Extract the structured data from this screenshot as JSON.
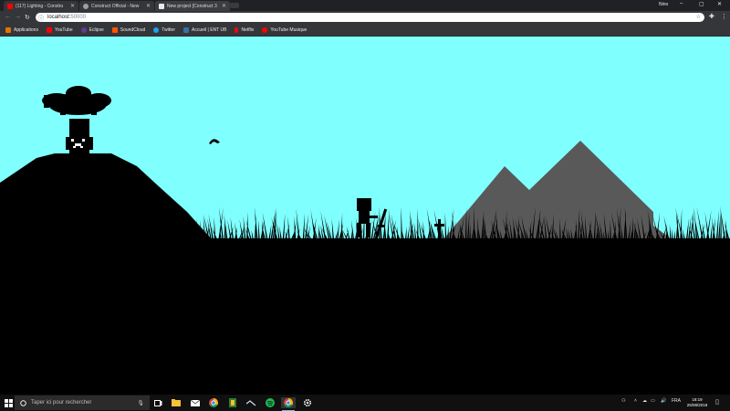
{
  "browser": {
    "tabs": [
      {
        "title": "(117) Lighting - Constru",
        "favicon_color": "#ff0000"
      },
      {
        "title": "Construct Official - New",
        "favicon_color": "#9aa0a6"
      },
      {
        "title": "New project [Construct 3",
        "favicon_color": "#e8eaed"
      }
    ],
    "profile_name": "Nino",
    "address_bar": {
      "host": "localhost:",
      "port": "50000"
    },
    "bookmarks": [
      {
        "label": "Applications",
        "icon_color": "#e37400"
      },
      {
        "label": "YouTube",
        "icon_color": "#ff0000"
      },
      {
        "label": "Eclipse",
        "icon_color": "#5e3d8f"
      },
      {
        "label": "SoundCloud",
        "icon_color": "#ff5500"
      },
      {
        "label": "Twitter",
        "icon_color": "#1da1f2"
      },
      {
        "label": "Accueil | ENT UB",
        "icon_color": "#3a6ea5"
      },
      {
        "label": "Netflix",
        "icon_color": "#e50914"
      },
      {
        "label": "YouTube Musique",
        "icon_color": "#ff0000"
      }
    ]
  },
  "game": {
    "sky_color": "#80ffff",
    "ground_color": "#000000",
    "mountain_color": "#595959"
  },
  "taskbar": {
    "search_placeholder": "Taper ici pour rechercher",
    "language": "FRA",
    "time": "18:19",
    "date": "25/08/2018",
    "accent_color": "#76b9ed"
  }
}
